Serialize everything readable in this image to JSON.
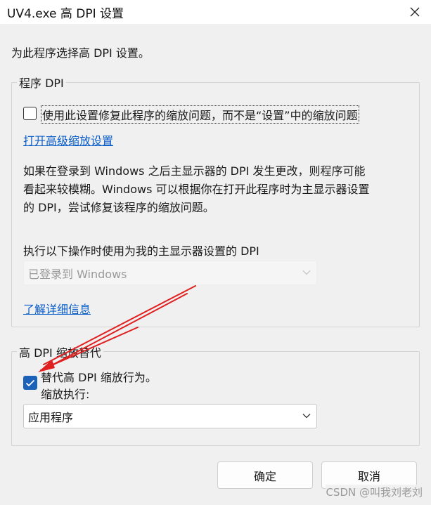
{
  "window": {
    "title": "UV4.exe 高 DPI 设置"
  },
  "intro": "为此程序选择高 DPI 设置。",
  "program_dpi": {
    "legend": "程序 DPI",
    "checkbox_label": "使用此设置修复此程序的缩放问题，而不是“设置”中的缩放问题",
    "checked": false,
    "advanced_link": "打开高级缩放设置",
    "description": [
      "如果在登录到 Windows 之后主显示器的 DPI 发生更改，则程序可能",
      "看起来较模糊。Windows 可以根据你在打开此程序时为主显示器设置",
      "的 DPI，尝试修复该程序的缩放问题。"
    ],
    "dpi_label": "执行以下操作时使用为我的主显示器设置的 DPI",
    "dpi_select_value": "已登录到 Windows",
    "learn_more_link": "了解详细信息"
  },
  "override": {
    "legend": "高 DPI 缩放替代",
    "checkbox_label": "替代高 DPI 缩放行为。",
    "checked": true,
    "zoom_label": "缩放执行:",
    "select_value": "应用程序"
  },
  "buttons": {
    "ok": "确定",
    "cancel": "取消"
  },
  "watermark": "CSDN @叫我刘老刘",
  "colors": {
    "accent": "#1c62b9",
    "link": "#0a5ec9",
    "annotation_arrow": "#e02020"
  },
  "icons": {
    "close": "close-icon",
    "chevron": "chevron-down-icon",
    "check": "checkmark-icon"
  }
}
